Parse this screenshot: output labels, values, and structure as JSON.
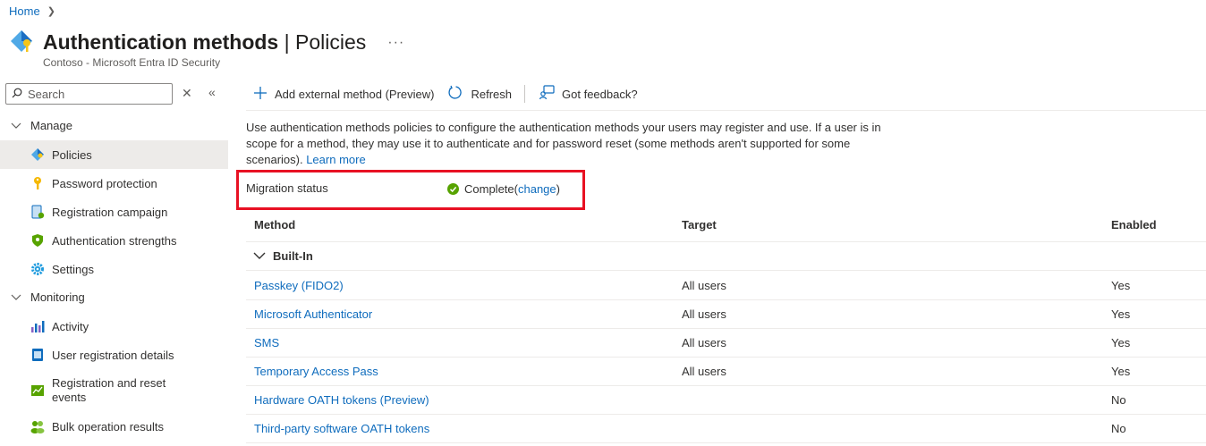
{
  "breadcrumb": {
    "home": "Home"
  },
  "header": {
    "title_main": "Authentication methods",
    "title_sep": " | ",
    "title_sub": "Policies",
    "more": "···",
    "subtitle": "Contoso - Microsoft Entra ID Security"
  },
  "sidebar": {
    "search_placeholder": "Search",
    "groups": [
      {
        "label": "Manage"
      },
      {
        "label": "Monitoring"
      }
    ],
    "items": [
      {
        "label": "Policies"
      },
      {
        "label": "Password protection"
      },
      {
        "label": "Registration campaign"
      },
      {
        "label": "Authentication strengths"
      },
      {
        "label": "Settings"
      },
      {
        "label": "Activity"
      },
      {
        "label": "User registration details"
      },
      {
        "label": "Registration and reset events"
      },
      {
        "label": "Bulk operation results"
      }
    ]
  },
  "toolbar": {
    "add_label": "Add external method (Preview)",
    "refresh_label": "Refresh",
    "feedback_label": "Got feedback?"
  },
  "description": {
    "text": "Use authentication methods policies to configure the authentication methods your users may register and use. If a user is in scope for a method, they may use it to authenticate and for password reset (some methods aren't supported for some scenarios). ",
    "link": "Learn more"
  },
  "migration": {
    "label": "Migration status",
    "status": "Complete",
    "open_paren": " (",
    "change_link": "change",
    "close_paren": ")"
  },
  "table": {
    "headers": {
      "method": "Method",
      "target": "Target",
      "enabled": "Enabled"
    },
    "group_label": "Built-In",
    "rows": [
      {
        "method": "Passkey (FIDO2)",
        "target": "All users",
        "enabled": "Yes"
      },
      {
        "method": "Microsoft Authenticator",
        "target": "All users",
        "enabled": "Yes"
      },
      {
        "method": "SMS",
        "target": "All users",
        "enabled": "Yes"
      },
      {
        "method": "Temporary Access Pass",
        "target": "All users",
        "enabled": "Yes"
      },
      {
        "method": "Hardware OATH tokens (Preview)",
        "target": "",
        "enabled": "No"
      },
      {
        "method": "Third-party software OATH tokens",
        "target": "",
        "enabled": "No"
      }
    ]
  },
  "colors": {
    "accent": "#0f6cbd",
    "highlight_border": "#e81123",
    "success": "#57a300"
  }
}
